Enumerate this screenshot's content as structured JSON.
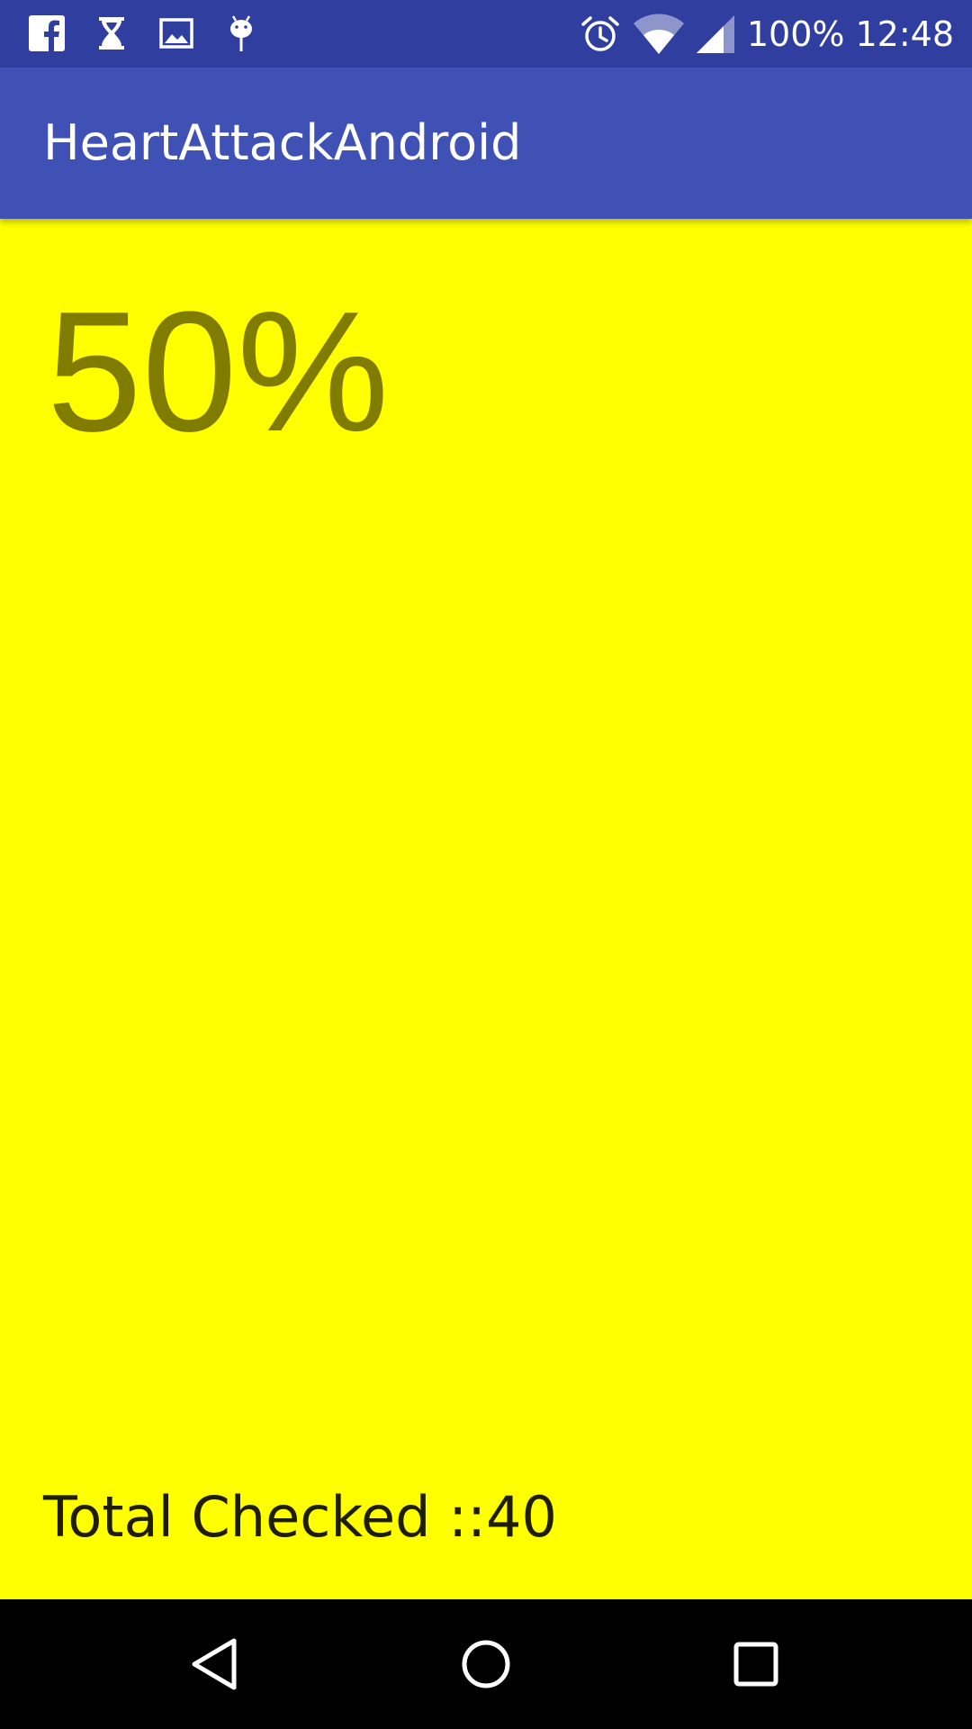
{
  "status_bar": {
    "left_icons": [
      "facebook-icon",
      "hourglass-icon",
      "image-icon",
      "android-debug-icon"
    ],
    "right_icons": [
      "alarm-icon",
      "wifi-icon",
      "signal-icon"
    ],
    "battery": "100%",
    "time": "12:48",
    "background": "#303f9f"
  },
  "app_bar": {
    "title": "HeartAttackAndroid",
    "background": "#3f51b5"
  },
  "main": {
    "background": "#ffff00",
    "percentage": "50%",
    "percentage_color": "#7f7c00",
    "total_checked": "Total Checked ::40"
  },
  "nav_bar": {
    "buttons": [
      "back-icon",
      "home-icon",
      "recents-icon"
    ]
  }
}
